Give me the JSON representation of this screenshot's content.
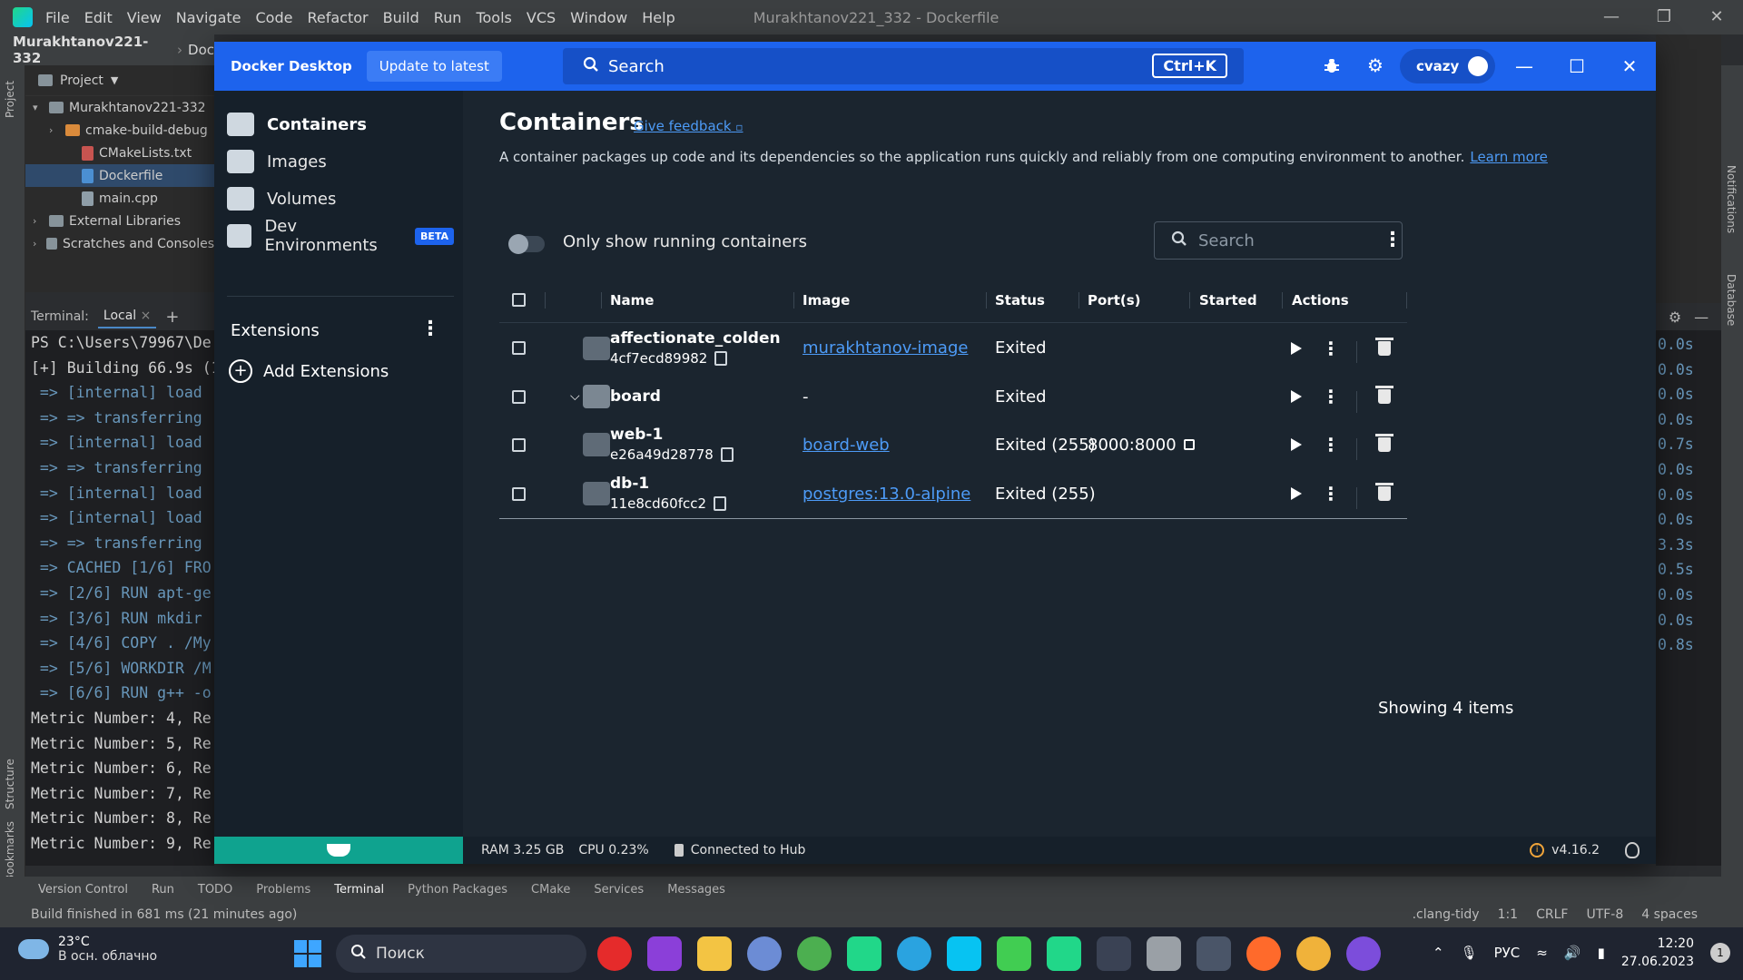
{
  "ide": {
    "menu": [
      "File",
      "Edit",
      "View",
      "Navigate",
      "Code",
      "Refactor",
      "Build",
      "Run",
      "Tools",
      "VCS",
      "Window",
      "Help"
    ],
    "window_title": "Murakhtanov221_332 - Dockerfile",
    "breadcrumb": [
      "Murakhtanov221-332",
      "Doc"
    ],
    "project_label": "Project",
    "tree": [
      {
        "label": "Murakhtanov221-332",
        "indent": 0,
        "icon": "folder"
      },
      {
        "label": "cmake-build-debug",
        "indent": 1,
        "icon": "folder-orange"
      },
      {
        "label": "CMakeLists.txt",
        "indent": 2,
        "icon": "file-red"
      },
      {
        "label": "Dockerfile",
        "indent": 2,
        "icon": "file-blue"
      },
      {
        "label": "main.cpp",
        "indent": 2,
        "icon": "file"
      },
      {
        "label": "External Libraries",
        "indent": 0,
        "icon": "lib"
      },
      {
        "label": "Scratches and Consoles",
        "indent": 0,
        "icon": "scratch"
      }
    ],
    "side_labels": {
      "project": "Project",
      "structure": "Structure",
      "bookmarks": "Bookmarks",
      "notifications": "Notifications",
      "database": "Database"
    },
    "terminal": {
      "label": "Terminal:",
      "tab": "Local",
      "lines": [
        {
          "text": "PS C:\\Users\\79967\\De",
          "blue": false
        },
        {
          "text": "[+] Building 66.9s (1",
          "blue": false
        },
        {
          "text": " => [internal] load ",
          "blue": true
        },
        {
          "text": " => => transferring ",
          "blue": true
        },
        {
          "text": " => [internal] load ",
          "blue": true
        },
        {
          "text": " => => transferring ",
          "blue": true
        },
        {
          "text": " => [internal] load ",
          "blue": true
        },
        {
          "text": " => [internal] load ",
          "blue": true
        },
        {
          "text": " => => transferring ",
          "blue": true
        },
        {
          "text": " => CACHED [1/6] FRO",
          "blue": true
        },
        {
          "text": " => [2/6] RUN apt-ge",
          "blue": true
        },
        {
          "text": " => [3/6] RUN mkdir ",
          "blue": true
        },
        {
          "text": " => [4/6] COPY . /My",
          "blue": true
        },
        {
          "text": " => [5/6] WORKDIR /M",
          "blue": true
        },
        {
          "text": " => [6/6] RUN g++ -o",
          "blue": true
        },
        {
          "text": "Metric Number: 4, Re",
          "blue": false
        },
        {
          "text": "Metric Number: 5, Re",
          "blue": false
        },
        {
          "text": "Metric Number: 6, Re",
          "blue": false
        },
        {
          "text": "Metric Number: 7, Re",
          "blue": false
        },
        {
          "text": "Metric Number: 8, Re",
          "blue": false
        },
        {
          "text": "Metric Number: 9, Re",
          "blue": false
        }
      ],
      "right_times": [
        "0.0s",
        "0.0s",
        "0.0s",
        "0.0s",
        "0.7s",
        "0.0s",
        "0.0s",
        "0.0s",
        "3.3s",
        "0.5s",
        "0.0s",
        "0.0s",
        "0.8s"
      ]
    },
    "bottom_tabs": [
      "Version Control",
      "Run",
      "TODO",
      "Problems",
      "Terminal",
      "Python Packages",
      "CMake",
      "Services",
      "Messages"
    ],
    "status_message": "Build finished in 681 ms (21 minutes ago)",
    "status_right": [
      ".clang-tidy",
      "1:1",
      "CRLF",
      "UTF-8",
      "4 spaces"
    ]
  },
  "docker": {
    "brand": "Docker Desktop",
    "update_label": "Update to latest",
    "search_label": "Search",
    "search_shortcut": "Ctrl+K",
    "user": "cvazy",
    "sidebar": {
      "items": [
        {
          "label": "Containers",
          "icon": "containers-icon",
          "active": true
        },
        {
          "label": "Images",
          "icon": "images-icon",
          "active": false
        },
        {
          "label": "Volumes",
          "icon": "volumes-icon",
          "active": false
        },
        {
          "label": "Dev Environments",
          "icon": "dev-environments-icon",
          "active": false,
          "badge": "BETA"
        }
      ],
      "extensions_label": "Extensions",
      "add_extensions_label": "Add Extensions"
    },
    "main": {
      "title": "Containers",
      "feedback_label": "Give feedback",
      "description": "A container packages up code and its dependencies so the application runs quickly and reliably from one computing environment to another.",
      "learn_more": "Learn more",
      "toggle_label": "Only show running containers",
      "table_search_placeholder": "Search",
      "columns": [
        "Name",
        "Image",
        "Status",
        "Port(s)",
        "Started",
        "Actions"
      ],
      "rows": [
        {
          "name": "affectionate_colden",
          "id": "4cf7ecd89982",
          "image": "murakhtanov-image",
          "status": "Exited",
          "ports": "",
          "stack": false
        },
        {
          "name": "board",
          "id": "",
          "image": "-",
          "status": "Exited",
          "ports": "",
          "stack": true
        },
        {
          "name": "web-1",
          "id": "e26a49d28778",
          "image": "board-web",
          "status": "Exited (255)",
          "ports": "8000:8000",
          "stack": false
        },
        {
          "name": "db-1",
          "id": "11e8cd60fcc2",
          "image": "postgres:13.0-alpine",
          "status": "Exited (255)",
          "ports": "",
          "stack": false
        }
      ],
      "showing": "Showing 4 items"
    },
    "footer": {
      "ram": "RAM 3.25 GB",
      "cpu": "CPU 0.23%",
      "hub": "Connected to Hub",
      "version": "v4.16.2"
    }
  },
  "taskbar": {
    "temp": "23°C",
    "weather": "В осн. облачно",
    "search_label": "Поиск",
    "lang": "РУС",
    "time": "12:20",
    "date": "27.06.2023",
    "notif_count": "1"
  },
  "colors": {
    "docker_blue": "#1d63ed",
    "link": "#4d9bf7",
    "sidebar_bg": "#16202a",
    "main_bg": "#1b252f",
    "footer_green": "#0fa38f"
  }
}
